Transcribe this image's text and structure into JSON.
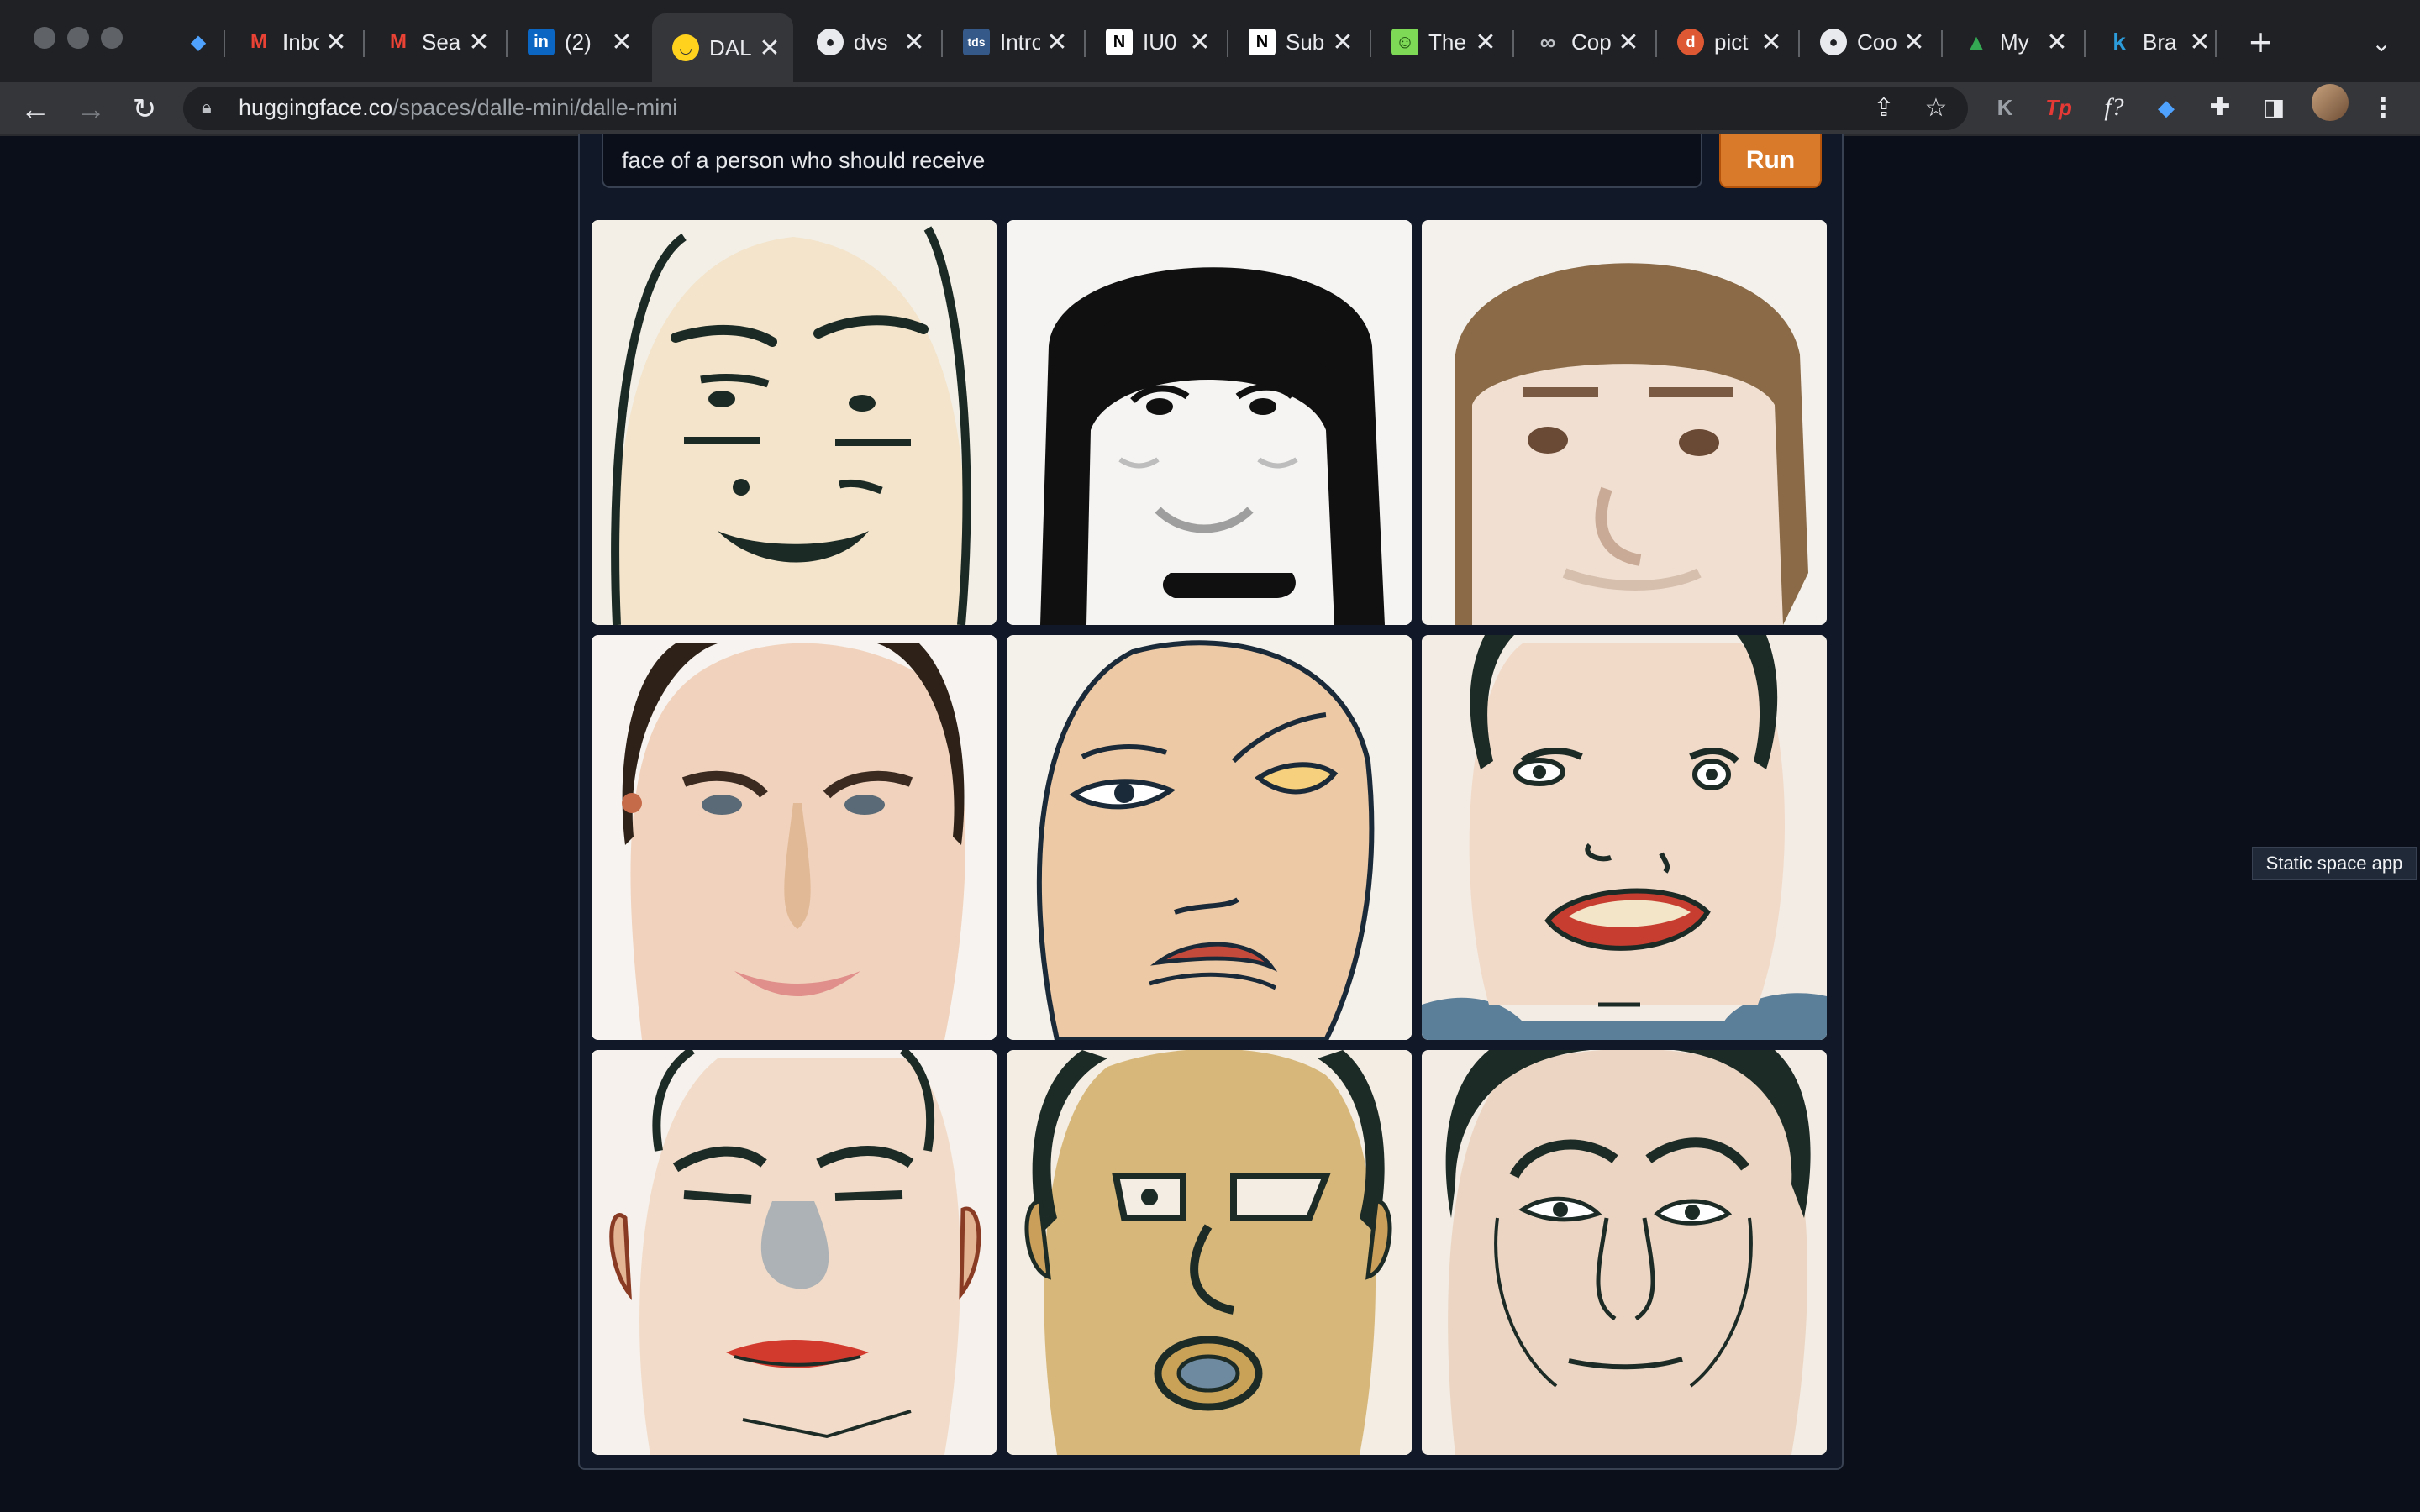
{
  "browser": {
    "tabs": [
      {
        "title": "",
        "icon": "gem-icon"
      },
      {
        "title": "Inbox",
        "icon": "gmail-icon"
      },
      {
        "title": "Search",
        "icon": "gmail-icon"
      },
      {
        "title": "(2)",
        "icon": "linkedin-icon"
      },
      {
        "title": "DALL·E",
        "icon": "hugging-face-icon",
        "active": true
      },
      {
        "title": "dvs",
        "icon": "github-icon"
      },
      {
        "title": "Intro",
        "icon": "tds-icon"
      },
      {
        "title": "IU0",
        "icon": "notion-icon"
      },
      {
        "title": "Sub",
        "icon": "notion-icon"
      },
      {
        "title": "The",
        "icon": "smiley-icon"
      },
      {
        "title": "Cop",
        "icon": "colab-icon"
      },
      {
        "title": "pict",
        "icon": "duckduckgo-icon"
      },
      {
        "title": "Coo",
        "icon": "github-icon"
      },
      {
        "title": "My",
        "icon": "google-drive-icon"
      },
      {
        "title": "Bra",
        "icon": "k-icon"
      }
    ],
    "url_host": "huggingface.co",
    "url_path": "/spaces/dalle-mini/dalle-mini",
    "extensions": [
      "K",
      "Tp",
      "f?",
      "◆",
      "✚"
    ]
  },
  "app": {
    "prompt_value": "face of a person who should receive",
    "run_label": "Run",
    "images": [
      {
        "name": "generated-face-1",
        "description": "cartoon face"
      },
      {
        "name": "generated-face-2",
        "description": "black hair cartoon"
      },
      {
        "name": "generated-face-3",
        "description": "brown hair face"
      },
      {
        "name": "generated-face-4",
        "description": "realistic man"
      },
      {
        "name": "generated-face-5",
        "description": "sketch face"
      },
      {
        "name": "generated-face-6",
        "description": "open mouth face"
      },
      {
        "name": "generated-face-7",
        "description": "ears face"
      },
      {
        "name": "generated-face-8",
        "description": "yellow face"
      },
      {
        "name": "generated-face-9",
        "description": "sketch man"
      }
    ]
  },
  "tooltip": "Static space app"
}
